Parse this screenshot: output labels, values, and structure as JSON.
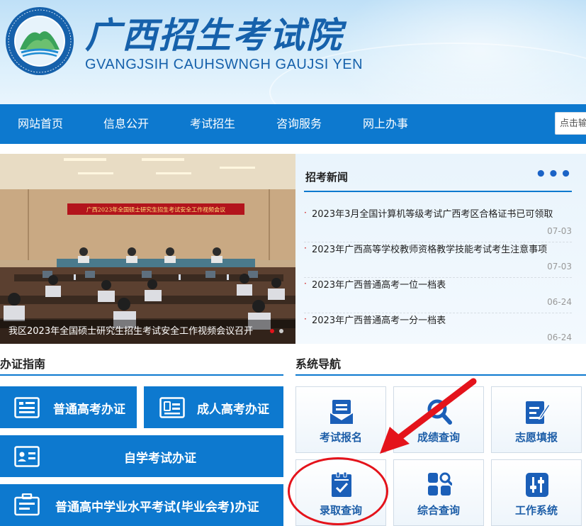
{
  "header": {
    "title": "广西招生考试院",
    "subtitle": "GVANGJSIH CAUHSWNGH GAUJSI YEN",
    "logo_ring_text": "广西招生考试院 · GVANGJSIH CAUHSWNGH GAUJSI YEN"
  },
  "nav": {
    "items": [
      {
        "label": "网站首页"
      },
      {
        "label": "信息公开"
      },
      {
        "label": "考试招生"
      },
      {
        "label": "咨询服务"
      },
      {
        "label": "网上办事"
      }
    ],
    "search_placeholder": "点击输"
  },
  "banner": {
    "photo_banner_text": "广西2023年全国硕士研究生招生考试安全工作视频会议",
    "caption": "我区2023年全国硕士研究生招生考试安全工作视频会议召开",
    "dot_colors": [
      "#e4131b",
      "#cccccc"
    ]
  },
  "news": {
    "title": "招考新闻",
    "more": "•••",
    "items": [
      {
        "text": "2023年3月全国计算机等级考试广西考区合格证书已可领取",
        "date": "07-03"
      },
      {
        "text": "2023年广西高等学校教师资格教学技能考试考生注意事项",
        "date": "07-03"
      },
      {
        "text": "2023年广西普通高考一位一档表",
        "date": "06-24"
      },
      {
        "text": "2023年广西普通高考一分一档表",
        "date": "06-24"
      }
    ]
  },
  "guide": {
    "title": "办证指南",
    "buttons": [
      {
        "label": "普通高考办证",
        "icon": "id-card-icon"
      },
      {
        "label": "成人高考办证",
        "icon": "id-badge-icon"
      },
      {
        "label": "自学考试办证",
        "icon": "profile-card-icon"
      },
      {
        "label": "普通高中学业水平考试(毕业会考)办证",
        "icon": "work-badge-icon"
      }
    ]
  },
  "system_nav": {
    "title": "系统导航",
    "tiles": [
      {
        "label": "考试报名",
        "icon": "registration-icon"
      },
      {
        "label": "成绩查询",
        "icon": "search-icon"
      },
      {
        "label": "志愿填报",
        "icon": "edit-form-icon"
      },
      {
        "label": "录取查询",
        "icon": "clipboard-check-icon"
      },
      {
        "label": "综合查询",
        "icon": "grid-search-icon"
      },
      {
        "label": "工作系统",
        "icon": "settings-sliders-icon"
      }
    ]
  },
  "colors": {
    "primary": "#0d79cf",
    "title_blue": "#1661ab",
    "annotation_red": "#e4131b"
  }
}
